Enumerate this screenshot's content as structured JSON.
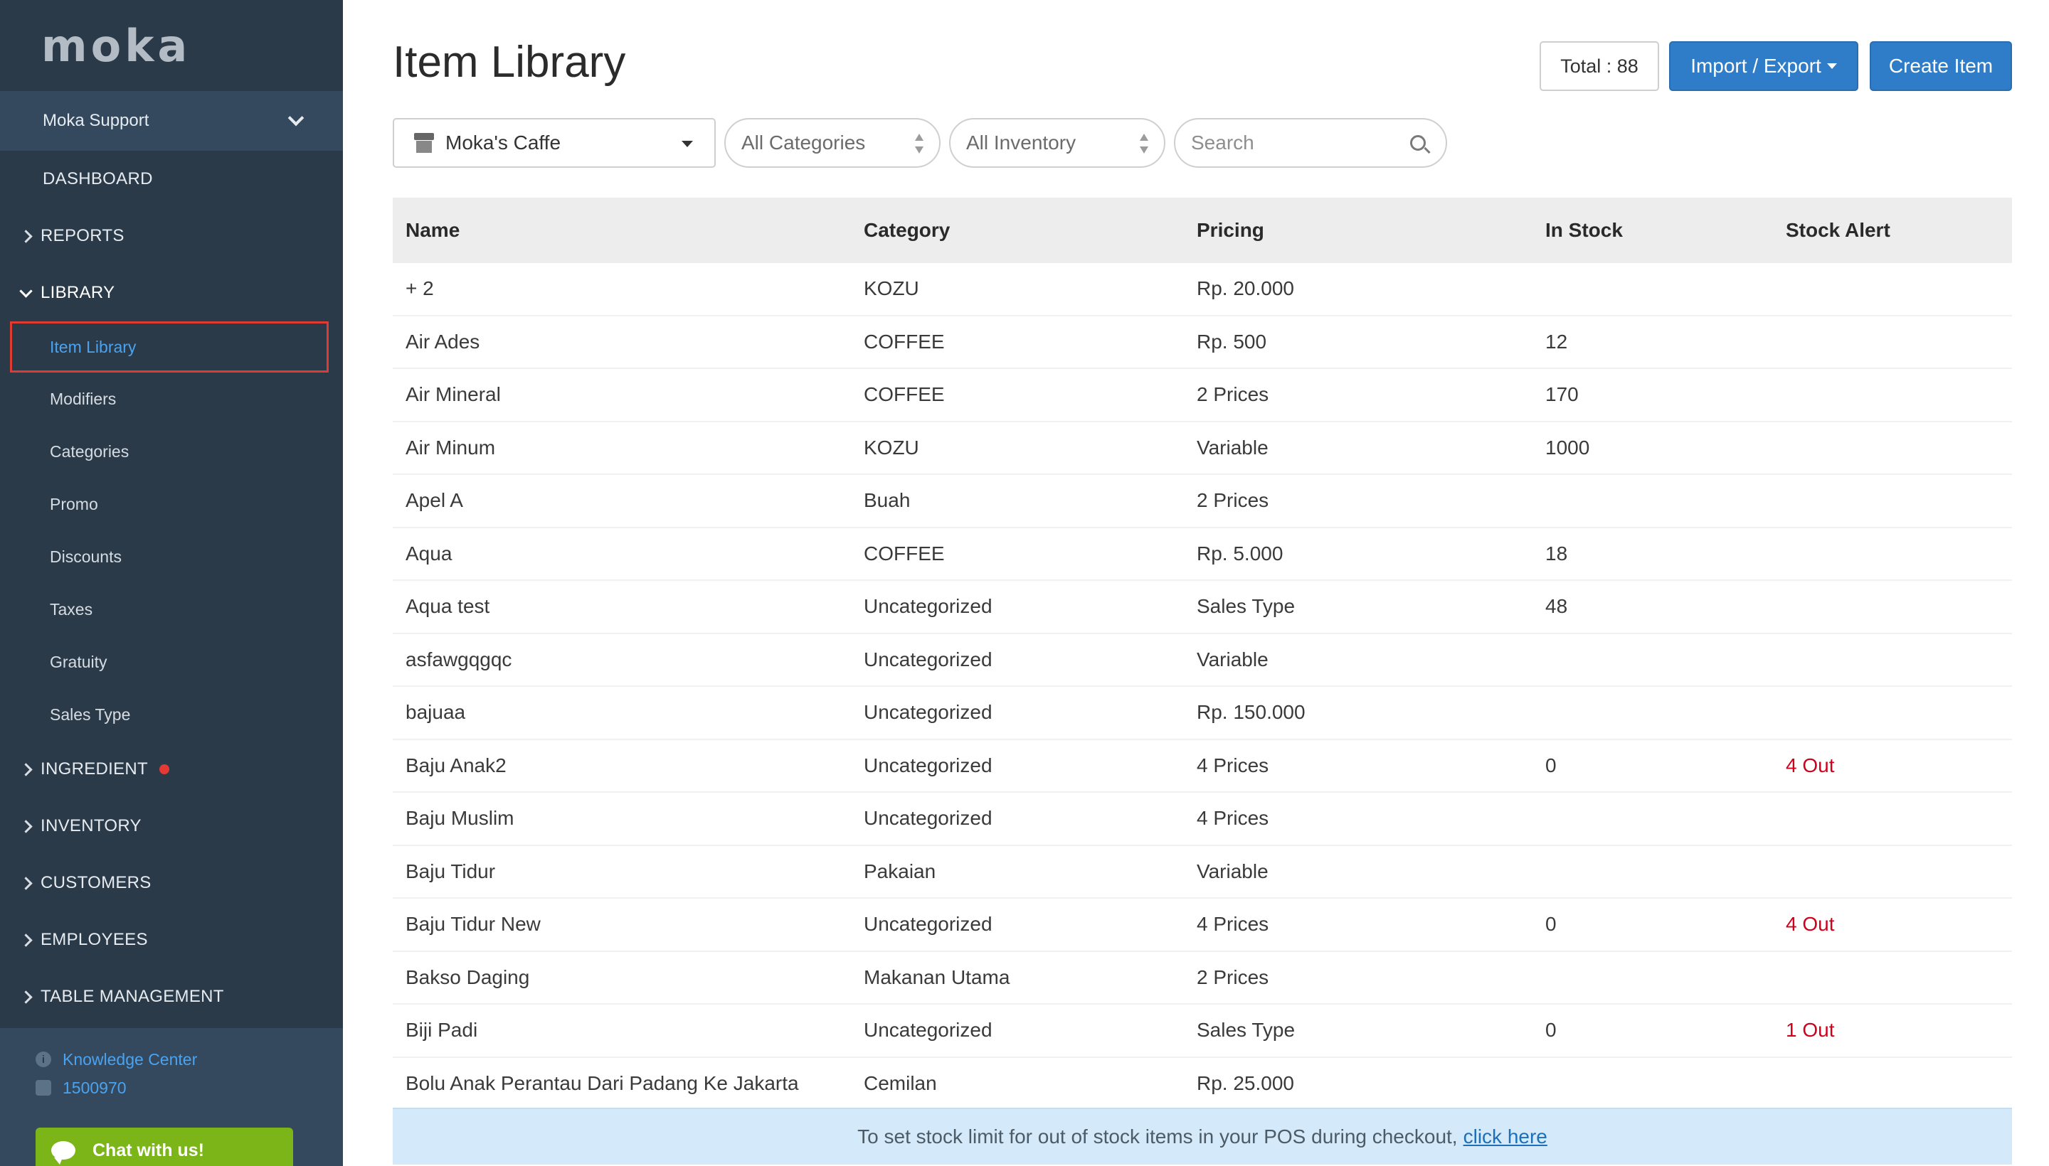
{
  "sidebar": {
    "logo": "moka",
    "user": "Moka Support",
    "dashboard": "DASHBOARD",
    "reports": "REPORTS",
    "library": "LIBRARY",
    "library_items": [
      "Item Library",
      "Modifiers",
      "Categories",
      "Promo",
      "Discounts",
      "Taxes",
      "Gratuity",
      "Sales Type"
    ],
    "ingredient": "INGREDIENT",
    "inventory": "INVENTORY",
    "customers": "CUSTOMERS",
    "employees": "EMPLOYEES",
    "table_management": "TABLE MANAGEMENT",
    "knowledge_center": "Knowledge Center",
    "phone": "1500970",
    "chat": "Chat with us!"
  },
  "header": {
    "title": "Item Library",
    "total": "Total : 88",
    "import_export": "Import / Export",
    "create_item": "Create Item"
  },
  "filters": {
    "outlet": "Moka's Caffe",
    "categories": "All Categories",
    "inventory": "All Inventory",
    "search_placeholder": "Search"
  },
  "table": {
    "columns": [
      "Name",
      "Category",
      "Pricing",
      "In Stock",
      "Stock Alert"
    ],
    "rows": [
      [
        "+ 2",
        "KOZU",
        "Rp. 20.000",
        "",
        ""
      ],
      [
        "Air Ades",
        "COFFEE",
        "Rp. 500",
        "12",
        ""
      ],
      [
        "Air Mineral",
        "COFFEE",
        "2 Prices",
        "170",
        ""
      ],
      [
        "Air Minum",
        "KOZU",
        "Variable",
        "1000",
        ""
      ],
      [
        "Apel A",
        "Buah",
        "2 Prices",
        "",
        ""
      ],
      [
        "Aqua",
        "COFFEE",
        "Rp. 5.000",
        "18",
        ""
      ],
      [
        "Aqua test",
        "Uncategorized",
        "Sales Type",
        "48",
        ""
      ],
      [
        "asfawgqgqc",
        "Uncategorized",
        "Variable",
        "",
        ""
      ],
      [
        "bajuaa",
        "Uncategorized",
        "Rp. 150.000",
        "",
        ""
      ],
      [
        "Baju Anak2",
        "Uncategorized",
        "4 Prices",
        "0",
        "4 Out"
      ],
      [
        "Baju Muslim",
        "Uncategorized",
        "4 Prices",
        "",
        ""
      ],
      [
        "Baju Tidur",
        "Pakaian",
        "Variable",
        "",
        ""
      ],
      [
        "Baju Tidur New",
        "Uncategorized",
        "4 Prices",
        "0",
        "4 Out"
      ],
      [
        "Bakso Daging",
        "Makanan Utama",
        "2 Prices",
        "",
        ""
      ],
      [
        "Biji Padi",
        "Uncategorized",
        "Sales Type",
        "0",
        "1 Out"
      ],
      [
        "Bolu Anak Perantau Dari Padang Ke Jakarta",
        "Cemilan",
        "Rp. 25.000",
        "",
        ""
      ]
    ]
  },
  "notice": {
    "text": "To set stock limit for out of stock items in your POS during checkout,",
    "link": "click here"
  }
}
